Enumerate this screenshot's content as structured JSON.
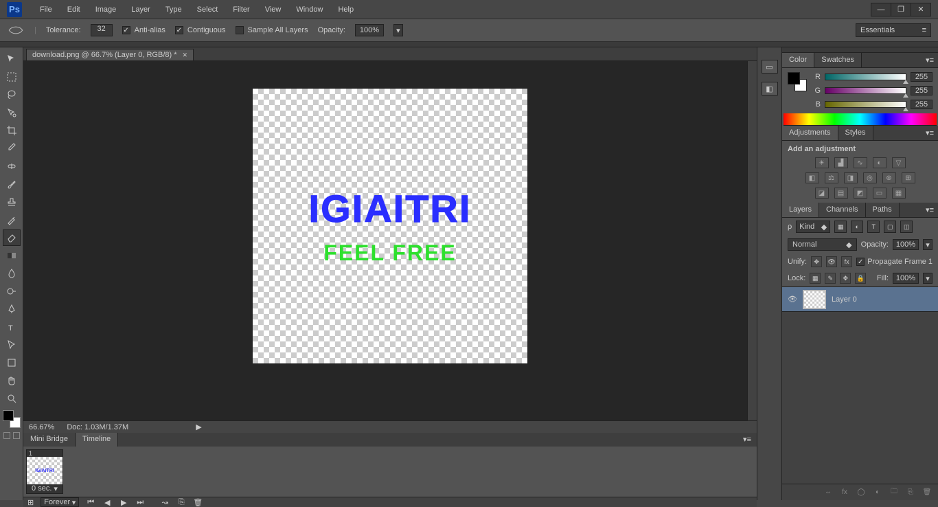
{
  "menu": {
    "items": [
      "File",
      "Edit",
      "Image",
      "Layer",
      "Type",
      "Select",
      "Filter",
      "View",
      "Window",
      "Help"
    ]
  },
  "optionbar": {
    "tolerance_label": "Tolerance:",
    "tolerance_value": "32",
    "antialias": "Anti-alias",
    "contiguous": "Contiguous",
    "sample_all": "Sample All Layers",
    "opacity_label": "Opacity:",
    "opacity_value": "100%",
    "workspace": "Essentials"
  },
  "document": {
    "tab_title": "download.png @ 66.7% (Layer 0, RGB/8) *",
    "canvas_text_main": "IGIAITRI",
    "canvas_text_sub": "FEEL FREE"
  },
  "status": {
    "zoom": "66.67%",
    "doc": "Doc: 1.03M/1.37M"
  },
  "timeline": {
    "tabs": [
      "Mini Bridge",
      "Timeline"
    ],
    "frame_num": "1",
    "frame_time": "0 sec.",
    "loop": "Forever"
  },
  "panels": {
    "color": {
      "tabs": [
        "Color",
        "Swatches"
      ],
      "r_label": "R",
      "r_val": "255",
      "g_label": "G",
      "g_val": "255",
      "b_label": "B",
      "b_val": "255"
    },
    "adjustments": {
      "tabs": [
        "Adjustments",
        "Styles"
      ],
      "heading": "Add an adjustment"
    },
    "layers": {
      "tabs": [
        "Layers",
        "Channels",
        "Paths"
      ],
      "kind_icon": "ρ",
      "kind": "Kind",
      "blend": "Normal",
      "opacity_label": "Opacity:",
      "opacity_value": "100%",
      "unify_label": "Unify:",
      "propagate": "Propagate Frame 1",
      "lock_label": "Lock:",
      "fill_label": "Fill:",
      "fill_value": "100%",
      "items": [
        {
          "name": "Layer 0"
        }
      ]
    }
  }
}
